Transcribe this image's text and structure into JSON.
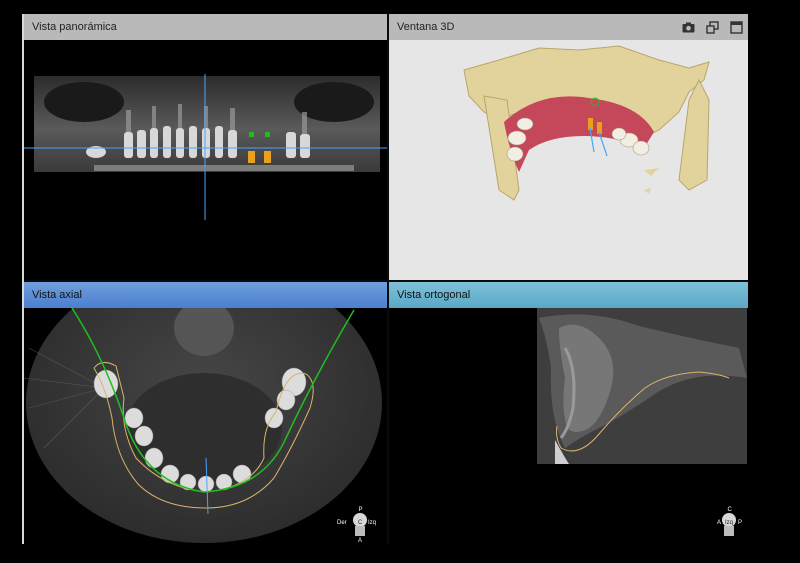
{
  "panes": {
    "panoramic": {
      "title": "Vista panorámica"
    },
    "view3d": {
      "title": "Ventana 3D",
      "icons": [
        "camera-icon",
        "restore-window-icon",
        "maximize-icon"
      ]
    },
    "axial": {
      "title": "Vista axial",
      "orient": {
        "top": "P",
        "left": "Der",
        "center": "C",
        "right": "Izq",
        "bottom": "A"
      }
    },
    "orthogonal": {
      "title": "Vista ortogonal",
      "orient": {
        "top": "C",
        "left": "A",
        "center": "Izq",
        "right": "P"
      }
    }
  },
  "colors": {
    "crosshair": "#4aa3ff",
    "arch_curve": "#1fbf1f",
    "implant": "#e8a020",
    "bone_outline": "#d9b46a",
    "gum": "#c4485a",
    "bone_3d": "#e2d39c"
  }
}
